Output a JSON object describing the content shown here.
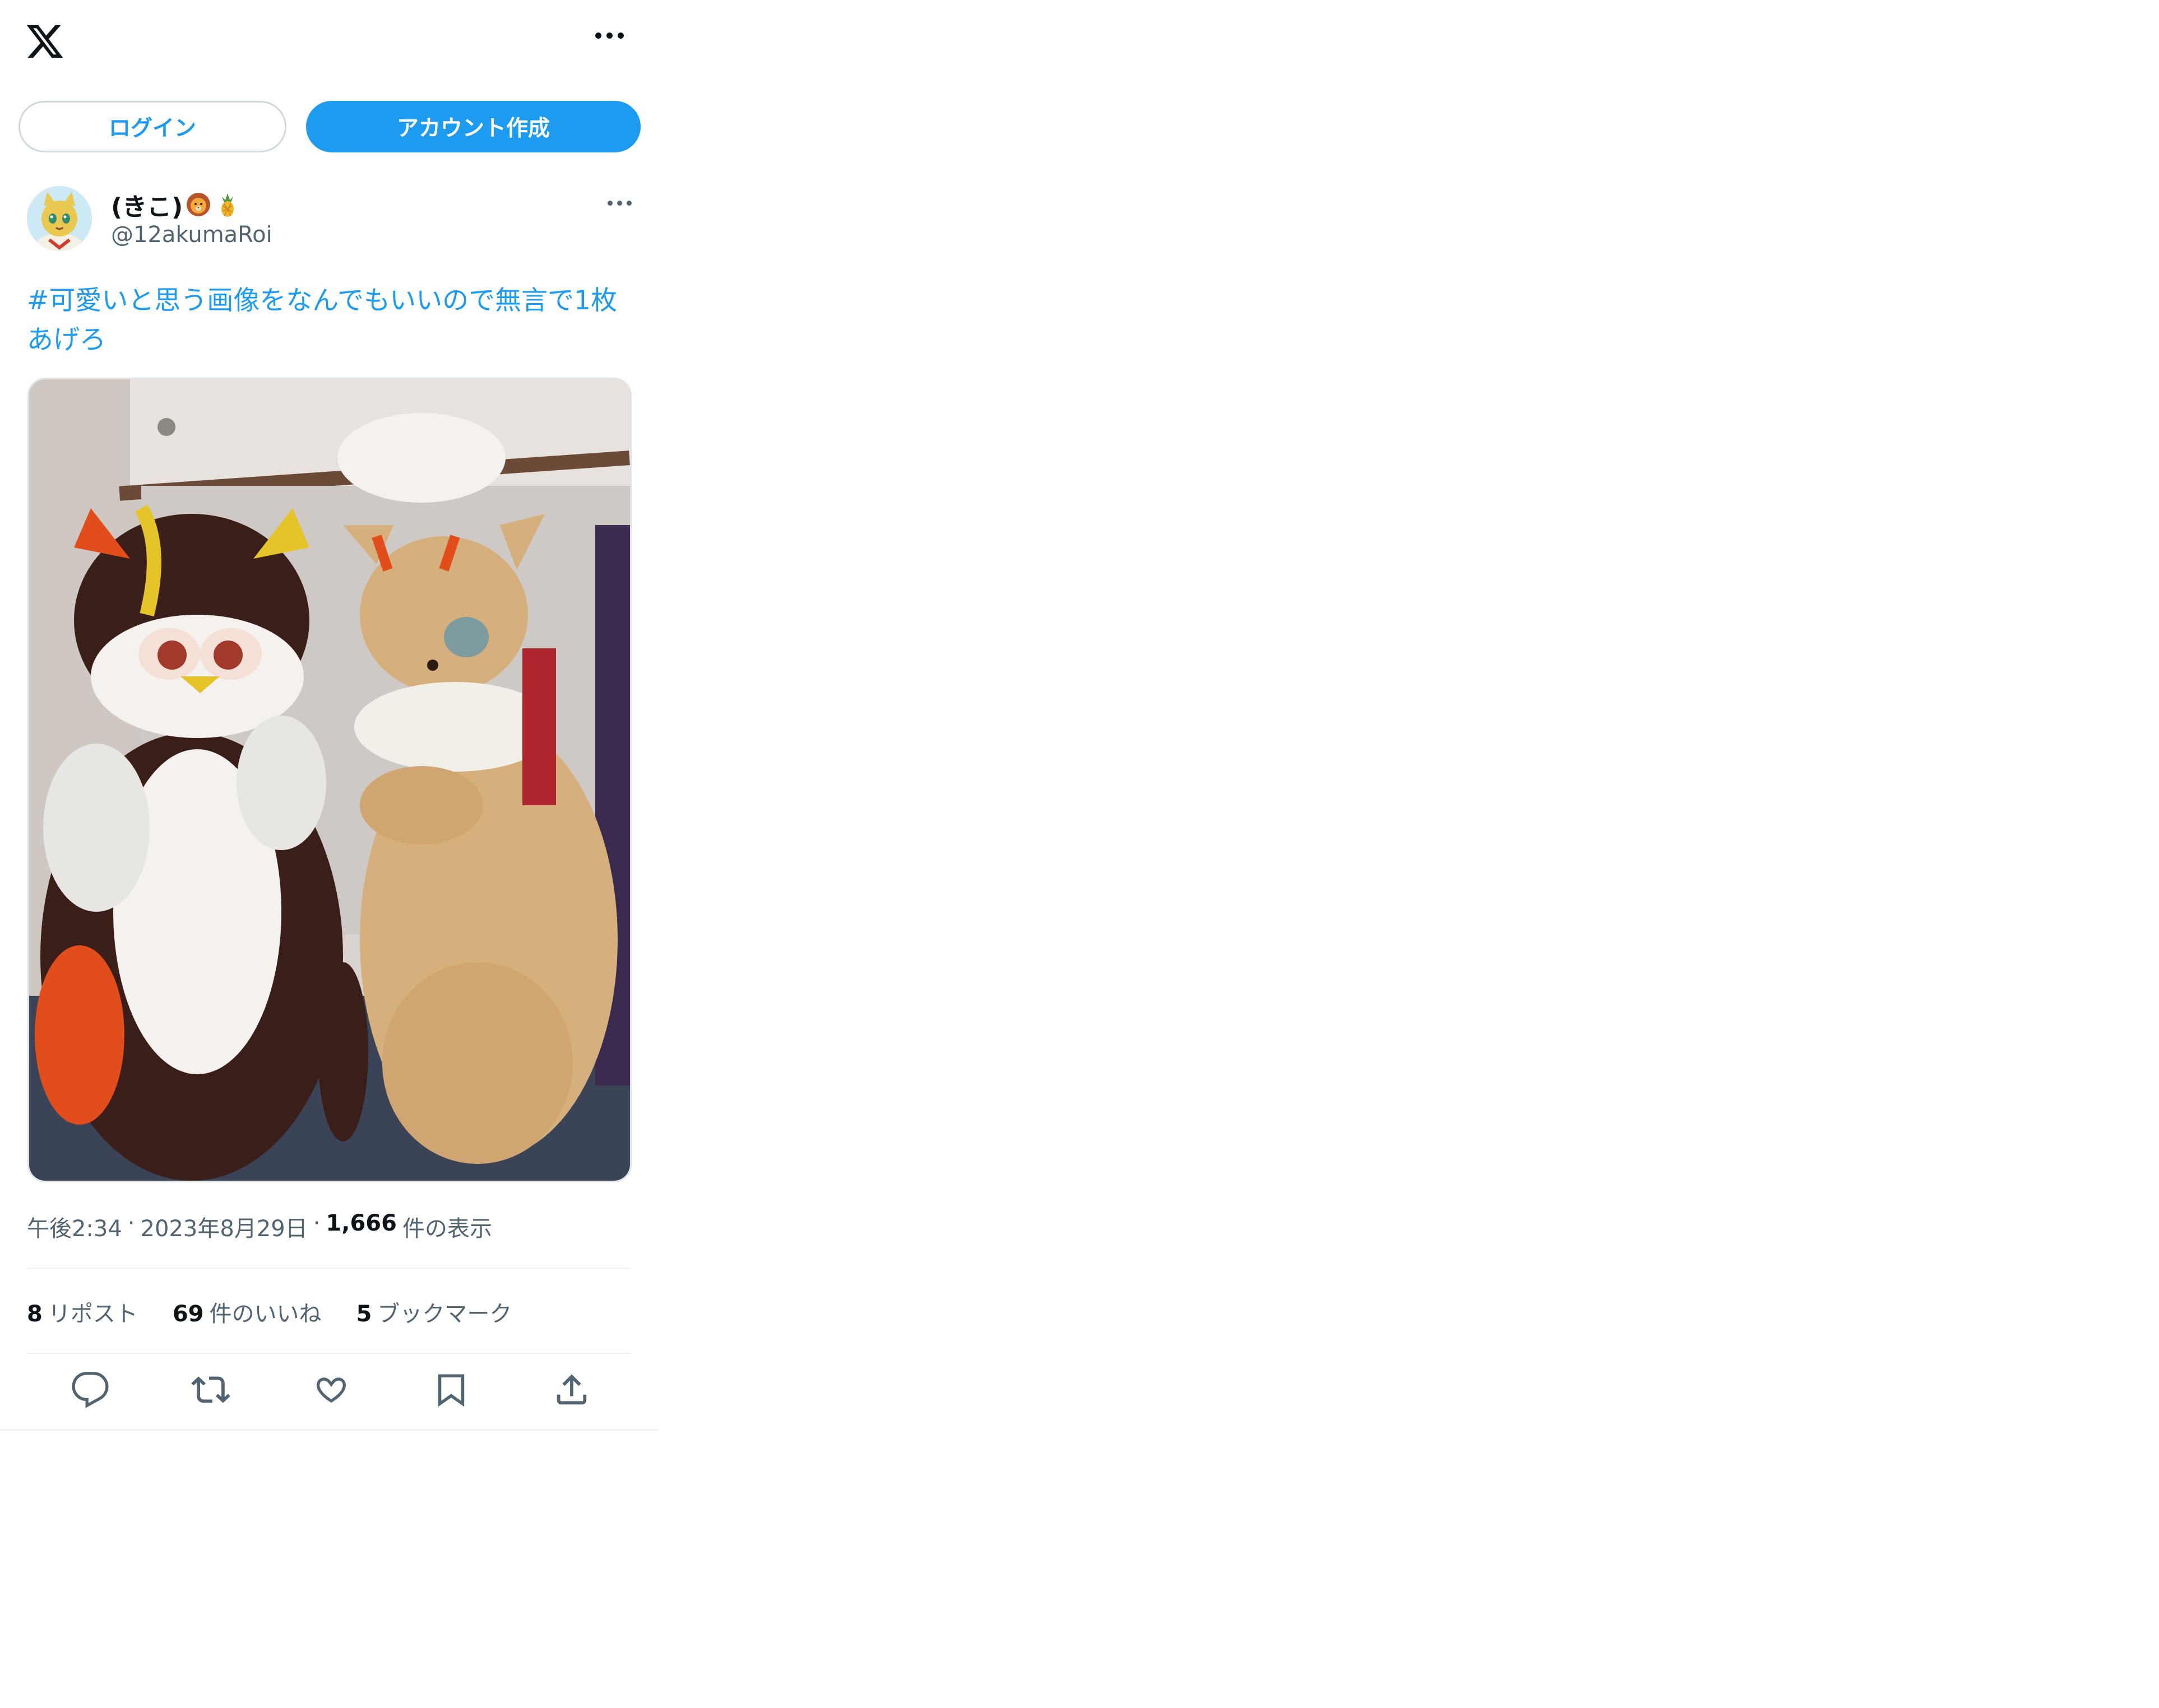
{
  "header": {
    "logo_icon": "x-logo-icon",
    "more_icon": "more-horizontal-icon"
  },
  "auth": {
    "login_label": "ログイン",
    "signup_label": "アカウント作成"
  },
  "tweet": {
    "display_name": "(きこ)",
    "name_emojis": [
      "lion-emoji",
      "pineapple-emoji"
    ],
    "handle": "@12akumaRoi",
    "text_line1": "#可愛いと思う画像をなんでもいいので無言で1枚",
    "text_line2": "あげろ",
    "photo_icon": "tweet-photo",
    "time": "午後2:34",
    "date": "2023年8月29日",
    "views_count": "1,666",
    "views_label": "件の表示",
    "separator": "·"
  },
  "stats": {
    "reposts_count": "8",
    "reposts_label": "リポスト",
    "likes_count": "69",
    "likes_label": "件のいいね",
    "bookmarks_count": "5",
    "bookmarks_label": "ブックマーク"
  },
  "actions": [
    "reply-icon",
    "repost-icon",
    "like-icon",
    "bookmark-icon",
    "share-icon"
  ],
  "colors": {
    "accent": "#1d9bf0",
    "text": "#0f1419",
    "secondary": "#536471",
    "border": "#cfd9de"
  }
}
